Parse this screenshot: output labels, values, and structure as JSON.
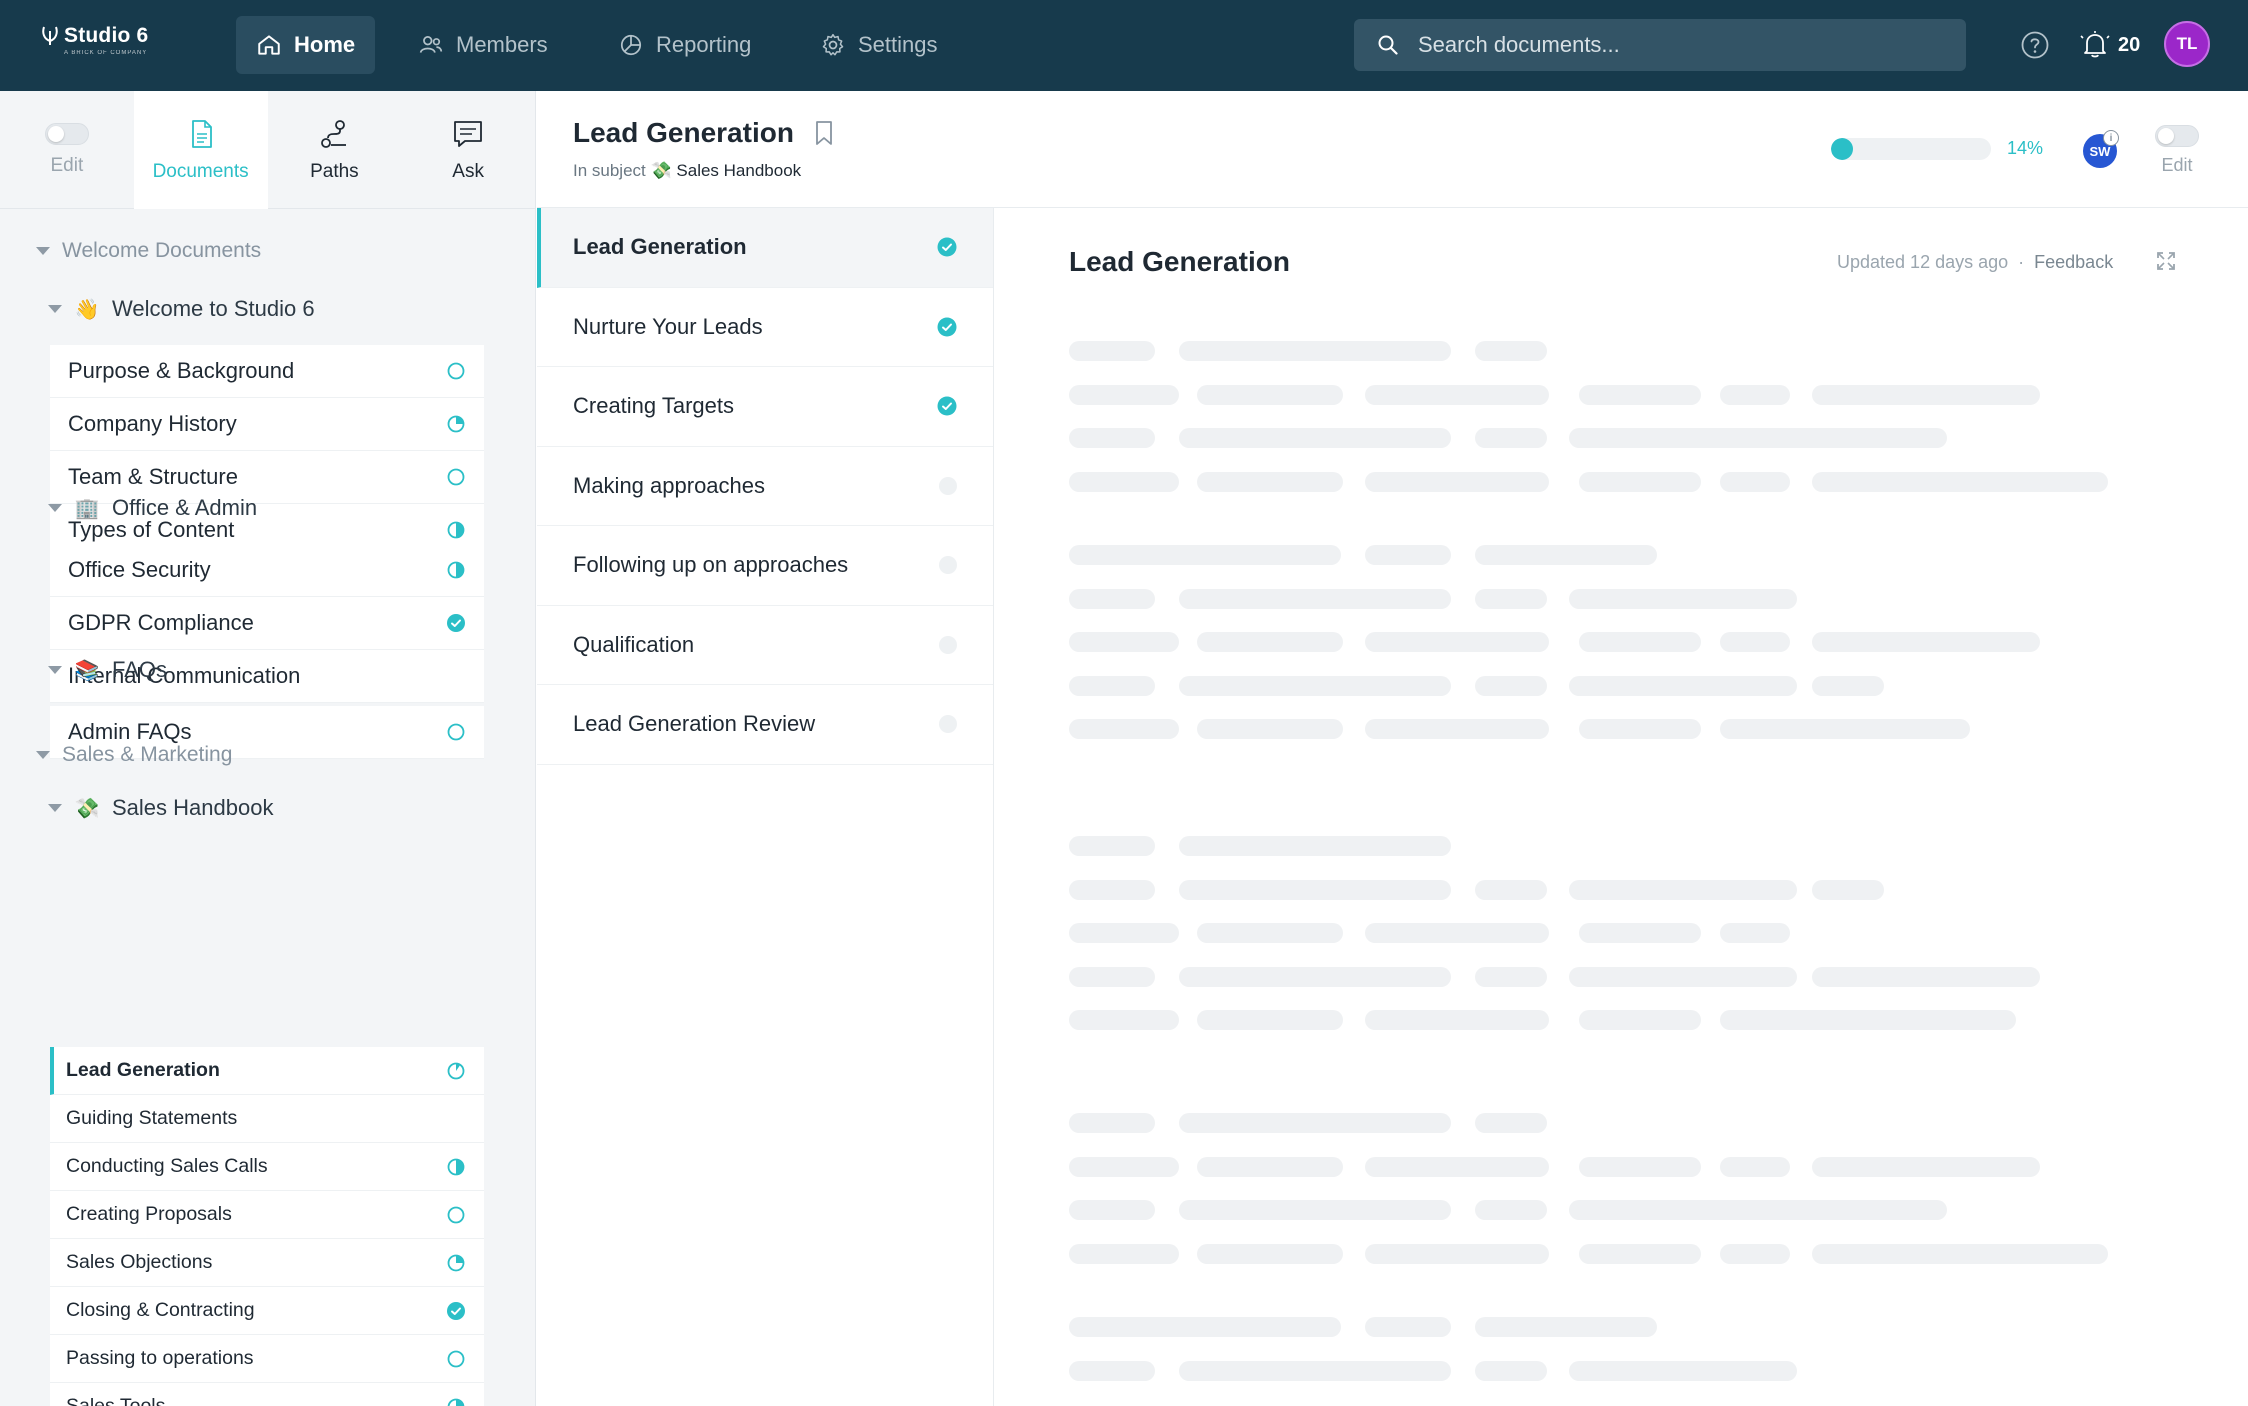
{
  "brand": {
    "name": "Studio 6",
    "tagline": "A BRICK OF COMPANY"
  },
  "nav": [
    {
      "label": "Home",
      "icon": "home-icon",
      "active": true
    },
    {
      "label": "Members",
      "icon": "members-icon",
      "active": false
    },
    {
      "label": "Reporting",
      "icon": "reporting-icon",
      "active": false
    },
    {
      "label": "Settings",
      "icon": "gear-icon",
      "active": false
    }
  ],
  "search": {
    "placeholder": "Search documents..."
  },
  "notifications": {
    "count": "20"
  },
  "user": {
    "initials": "TL"
  },
  "left_tabs": [
    {
      "label": "Edit"
    },
    {
      "label": "Documents"
    },
    {
      "label": "Paths"
    },
    {
      "label": "Ask"
    }
  ],
  "tree": {
    "welcome": {
      "label": "Welcome Documents",
      "groups": [
        {
          "label": "Welcome to Studio 6",
          "emoji": "👋",
          "items": [
            {
              "label": "Purpose & Background",
              "status": "empty"
            },
            {
              "label": "Company History",
              "status": "quarter"
            },
            {
              "label": "Team & Structure",
              "status": "empty"
            },
            {
              "label": "Types of Content",
              "status": "half"
            }
          ]
        },
        {
          "label": "Office & Admin",
          "emoji": "🏢",
          "items": [
            {
              "label": "Office Security",
              "status": "half"
            },
            {
              "label": "GDPR Compliance",
              "status": "done"
            },
            {
              "label": "Internal Communication",
              "status": "none"
            }
          ]
        },
        {
          "label": "FAQs",
          "emoji": "📚",
          "items": [
            {
              "label": "Admin FAQs",
              "status": "empty"
            }
          ]
        }
      ]
    },
    "sales": {
      "label": "Sales & Marketing",
      "groups": [
        {
          "label": "Sales Handbook",
          "emoji": "💸",
          "items": [
            {
              "label": "Lead Generation",
              "status": "eighth",
              "selected": true
            },
            {
              "label": "Guiding Statements",
              "status": "none"
            },
            {
              "label": "Conducting Sales Calls",
              "status": "half"
            },
            {
              "label": "Creating Proposals",
              "status": "empty"
            },
            {
              "label": "Sales Objections",
              "status": "quarter"
            },
            {
              "label": "Closing & Contracting",
              "status": "done"
            },
            {
              "label": "Passing to operations",
              "status": "empty"
            },
            {
              "label": "Sales Tools",
              "status": "quarter"
            }
          ]
        }
      ]
    }
  },
  "doc": {
    "title": "Lead Generation",
    "subject_prefix": "In subject",
    "subject_emoji": "💸",
    "subject": "Sales Handbook",
    "progress": 14,
    "progress_label": "14%",
    "reviewer_initials": "SW",
    "info_glyph": "i",
    "edit_label": "Edit"
  },
  "chapters": [
    {
      "label": "Lead Generation",
      "done": true,
      "active": true
    },
    {
      "label": "Nurture Your Leads",
      "done": true
    },
    {
      "label": "Creating Targets",
      "done": true
    },
    {
      "label": "Making approaches",
      "done": false
    },
    {
      "label": "Following up on approaches",
      "done": false
    },
    {
      "label": "Qualification",
      "done": false
    },
    {
      "label": "Lead Generation Review",
      "done": false
    }
  ],
  "content": {
    "title": "Lead Generation",
    "updated": "Updated 12 days ago",
    "separator": "·",
    "feedback": "Feedback"
  },
  "colors": {
    "accent": "#2bbfc7",
    "nav_bg": "#173a4c",
    "avatar": "#9b27c9",
    "reviewer": "#2757d3"
  }
}
